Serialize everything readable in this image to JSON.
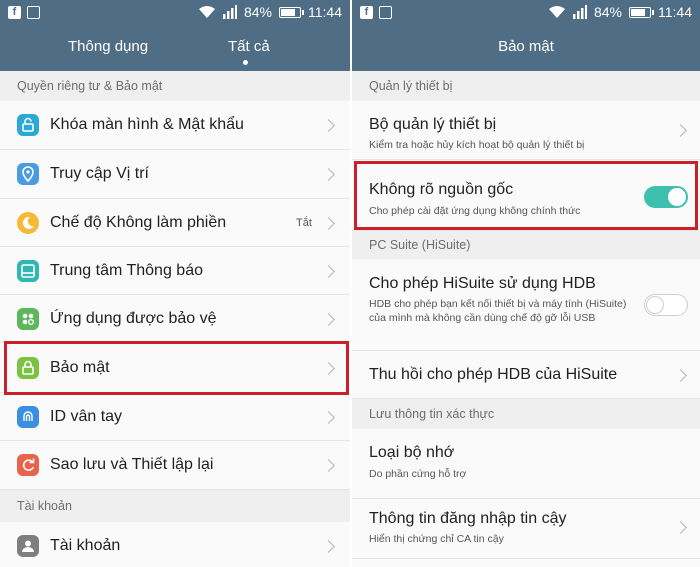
{
  "status_bar": {
    "battery": "84%",
    "time": "11:44",
    "battery_level": 0.84
  },
  "left": {
    "tabs": [
      "Thông dụng",
      "Tất cả"
    ],
    "active_tab": "Tất cả",
    "sections": [
      {
        "title": "Quyền riêng tư & Bảo mật",
        "items": [
          {
            "label": "Khóa màn hình & Mật khẩu",
            "icon": "lock-screen-icon",
            "color": "#2ba8d6"
          },
          {
            "label": "Truy cập Vị trí",
            "icon": "location-icon",
            "color": "#4a9be0"
          },
          {
            "label": "Chế độ Không làm phiền",
            "icon": "moon-icon",
            "color": "#f5b935",
            "value": "Tắt"
          },
          {
            "label": "Trung tâm Thông báo",
            "icon": "notification-center-icon",
            "color": "#2fb7b0"
          },
          {
            "label": "Ứng dụng được bảo vệ",
            "icon": "protected-apps-icon",
            "color": "#5cb85c"
          },
          {
            "label": "Bảo mật",
            "icon": "security-lock-icon",
            "color": "#7cc242"
          },
          {
            "label": "ID vân tay",
            "icon": "fingerprint-icon",
            "color": "#3b8fe0"
          },
          {
            "label": "Sao lưu và Thiết lập lại",
            "icon": "backup-reset-icon",
            "color": "#e8634a"
          }
        ]
      },
      {
        "title": "Tài khoản",
        "items": [
          {
            "label": "Tài khoản",
            "icon": "account-icon",
            "color": "#7f7f7f"
          }
        ]
      }
    ]
  },
  "right": {
    "title": "Bảo mật",
    "sections": [
      {
        "title": "Quản lý thiết bị",
        "items": [
          {
            "label": "Bộ quản lý thiết bị",
            "desc": "Kiểm tra hoặc hủy kích hoạt bộ quản lý thiết bị",
            "control": "chevron"
          },
          {
            "label": "Không rõ nguồn gốc",
            "desc": "Cho phép cài đặt ứng dụng không chính thức",
            "control": "toggle",
            "on": true
          }
        ]
      },
      {
        "title": "PC Suite (HiSuite)",
        "items": [
          {
            "label": "Cho phép HiSuite sử dụng HDB",
            "desc": "HDB cho phép bạn kết nối thiết bị và máy tính (HiSuite) của mình mà không cần dùng chế độ gỡ lỗi USB",
            "control": "toggle",
            "on": false
          },
          {
            "label": "Thu hồi cho phép HDB của HiSuite",
            "control": "chevron"
          }
        ]
      },
      {
        "title": "Lưu thông tin xác thực",
        "items": [
          {
            "label": "Loại bộ nhớ",
            "desc": "Do phần cứng hỗ trợ",
            "control": "none"
          },
          {
            "label": "Thông tin đăng nhập tin cậy",
            "desc": "Hiển thị chứng chỉ CA tin cậy",
            "control": "chevron"
          }
        ]
      }
    ]
  },
  "colors": {
    "header": "#4f6e86",
    "toggle_on": "#3fbfad",
    "highlight": "#c9202a"
  }
}
